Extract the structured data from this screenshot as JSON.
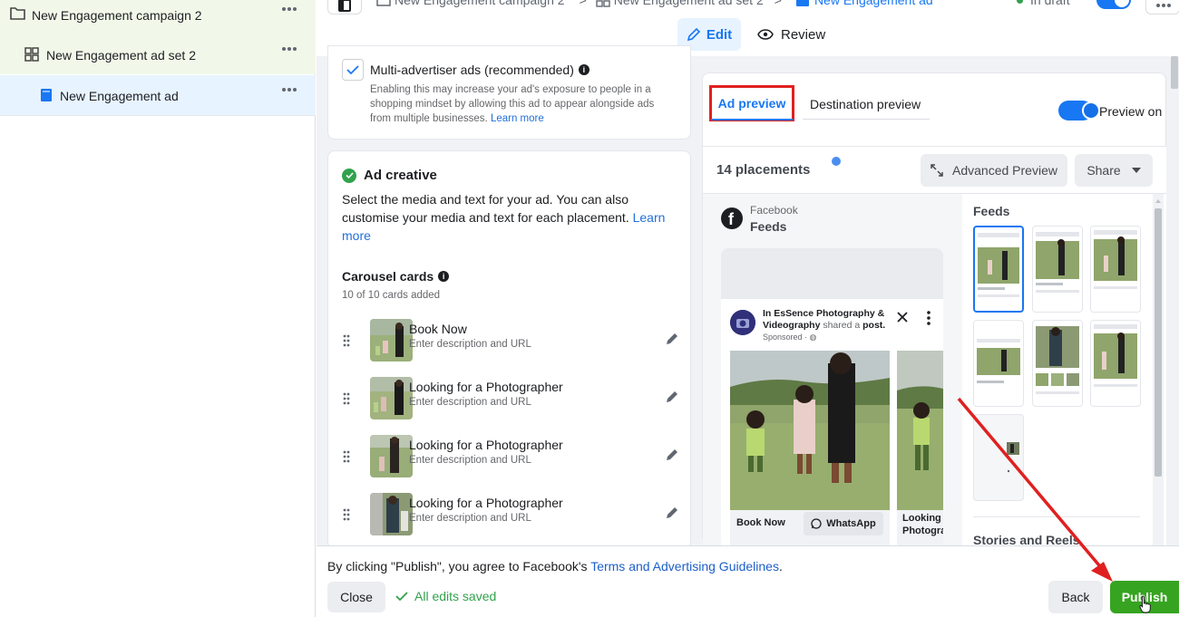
{
  "sidebar": {
    "items": [
      {
        "label": "New Engagement campaign 2"
      },
      {
        "label": "New Engagement ad set 2"
      },
      {
        "label": "New Engagement ad"
      }
    ]
  },
  "topbar": {
    "breadcrumbs": [
      "New Engagement campaign 2",
      "New Engagement ad set 2",
      "New Engagement ad"
    ],
    "status": "In draft",
    "edit_label": "Edit",
    "review_label": "Review"
  },
  "multi_advertiser": {
    "label": "Multi-advertiser ads (recommended)",
    "description": "Enabling this may increase your ad's exposure to people in a shopping mindset by allowing this ad to appear alongside ads from multiple businesses.",
    "learn_more": "Learn more",
    "checked": true
  },
  "ad_creative": {
    "title": "Ad creative",
    "description": "Select the media and text for your ad. You can also customise your media and text for each placement.",
    "learn_more": "Learn more",
    "carousel_title": "Carousel cards",
    "carousel_count": "10 of 10 cards added",
    "cards": [
      {
        "title": "Book Now",
        "subtitle": "Enter description and URL"
      },
      {
        "title": "Looking for a Photographer",
        "subtitle": "Enter description and URL"
      },
      {
        "title": "Looking for a Photographer",
        "subtitle": "Enter description and URL"
      },
      {
        "title": "Looking for a Photographer",
        "subtitle": "Enter description and URL"
      }
    ]
  },
  "preview": {
    "tabs": [
      "Ad preview",
      "Destination preview"
    ],
    "preview_toggle_label": "Preview on",
    "placements_count": "14 placements",
    "advanced_preview": "Advanced Preview",
    "share": "Share",
    "platform": "Facebook",
    "placement": "Feeds",
    "post": {
      "page_name": "In EsSence Photography & Videography",
      "action": "shared a",
      "object": "post.",
      "sponsored": "Sponsored · ",
      "card1_title": "Book Now",
      "card1_cta": "WhatsApp",
      "card2_title": "Looking for a Photographer"
    },
    "right_panel": {
      "feeds_title": "Feeds",
      "stories_title": "Stories and Reels"
    }
  },
  "footer": {
    "notice_prefix": "By clicking \"Publish\", you agree to Facebook's",
    "notice_link": "Terms and Advertising Guidelines",
    "notice_suffix": ".",
    "close": "Close",
    "saved": "All edits saved",
    "back": "Back",
    "publish": "Publish"
  },
  "colors": {
    "accent": "#1877f2",
    "publish_green": "#36a420",
    "annotation_red": "#e02020",
    "saved_green": "#31a24c"
  }
}
